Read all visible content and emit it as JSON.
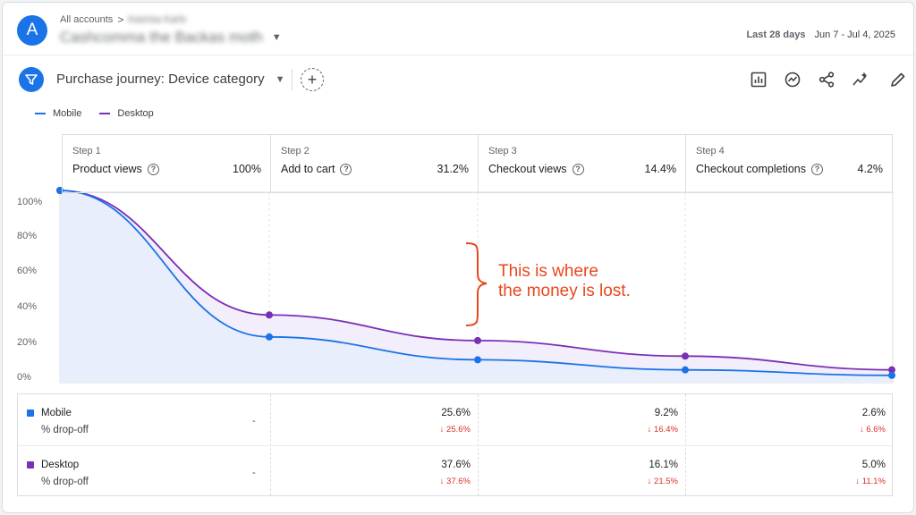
{
  "header": {
    "avatar_letter": "A",
    "breadcrumb_root": "All accounts",
    "breadcrumb_sep": ">",
    "breadcrumb_account": "Kasrisa Karls",
    "property_name": "Cashcomma the Backas moth",
    "date_label": "Last 28 days",
    "date_range": "Jun 7 - Jul 4, 2025"
  },
  "toolbar": {
    "exploration_title": "Purchase journey: Device category",
    "add_label": "+",
    "icons": [
      "report-icon",
      "insights-icon",
      "share-icon",
      "sparkle-icon",
      "edit-icon"
    ]
  },
  "legend": [
    {
      "name": "Mobile",
      "color": "#1a73e8"
    },
    {
      "name": "Desktop",
      "color": "#7b2fb5"
    }
  ],
  "steps": [
    {
      "num": "Step 1",
      "name": "Product views",
      "pct": "100%"
    },
    {
      "num": "Step 2",
      "name": "Add to cart",
      "pct": "31.2%"
    },
    {
      "num": "Step 3",
      "name": "Checkout views",
      "pct": "14.4%"
    },
    {
      "num": "Step 4",
      "name": "Checkout completions",
      "pct": "4.2%"
    }
  ],
  "chart_data": {
    "type": "line",
    "categories": [
      "Product views",
      "Add to cart",
      "Checkout views",
      "Checkout completions"
    ],
    "yticks": [
      "100%",
      "80%",
      "60%",
      "40%",
      "20%",
      "0%"
    ],
    "ylim": [
      0,
      105
    ],
    "grid": false,
    "legend_position": "top-left",
    "series": [
      {
        "name": "Mobile",
        "color": "#1a73e8",
        "values": [
          105,
          25,
          12.5,
          7,
          4
        ]
      },
      {
        "name": "Desktop",
        "color": "#7b2fb5",
        "values": [
          105,
          37,
          23,
          14.5,
          7
        ]
      }
    ]
  },
  "annotation": {
    "line1": "This is where",
    "line2": "the money is lost.",
    "color": "#e8471c"
  },
  "table": {
    "rows": [
      {
        "device": "Mobile",
        "color": "#1a73e8",
        "dropoff_label": "% drop-off",
        "step1": "-",
        "cells": [
          {
            "value": "25.6%",
            "drop": "↓ 25.6%"
          },
          {
            "value": "9.2%",
            "drop": "↓ 16.4%"
          },
          {
            "value": "2.6%",
            "drop": "↓ 6.6%"
          }
        ]
      },
      {
        "device": "Desktop",
        "color": "#7b2fb5",
        "dropoff_label": "% drop-off",
        "step1": "-",
        "cells": [
          {
            "value": "37.6%",
            "drop": "↓ 37.6%"
          },
          {
            "value": "16.1%",
            "drop": "↓ 21.5%"
          },
          {
            "value": "5.0%",
            "drop": "↓ 11.1%"
          }
        ]
      }
    ]
  }
}
